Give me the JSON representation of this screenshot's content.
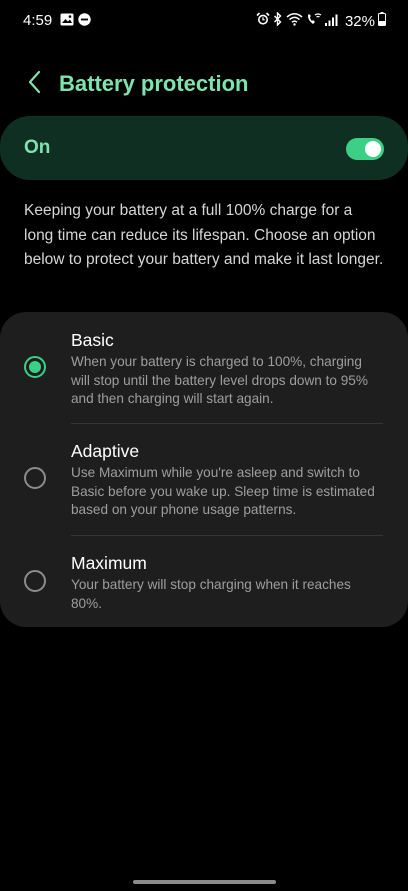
{
  "status_bar": {
    "time": "4:59",
    "left_icons": [
      "gallery-icon",
      "do-not-disturb-icon"
    ],
    "right_icons": [
      "alarm-icon",
      "bluetooth-icon",
      "wifi-icon",
      "wifi-calling-icon",
      "signal-icon"
    ],
    "battery_percent": "32%"
  },
  "header": {
    "back_icon": "chevron-left-icon",
    "title": "Battery protection"
  },
  "master_switch": {
    "label": "On",
    "enabled": true
  },
  "description": "Keeping your battery at a full 100% charge for a long time can reduce its lifespan. Choose an option below to protect your battery and make it last longer.",
  "options": [
    {
      "title": "Basic",
      "description": "When your battery is charged to 100%, charging will stop until the battery level drops down to 95% and then charging will start again.",
      "selected": true
    },
    {
      "title": "Adaptive",
      "description": "Use Maximum while you're asleep and switch to Basic before you wake up. Sleep time is estimated based on your phone usage patterns.",
      "selected": false
    },
    {
      "title": "Maximum",
      "description": "Your battery will stop charging when it reaches 80%.",
      "selected": false
    }
  ],
  "colors": {
    "accent": "#7fe3ae",
    "toggle_on": "#3ccf86",
    "switch_bg": "#0f2f22",
    "card_bg": "#1e1e1e"
  }
}
